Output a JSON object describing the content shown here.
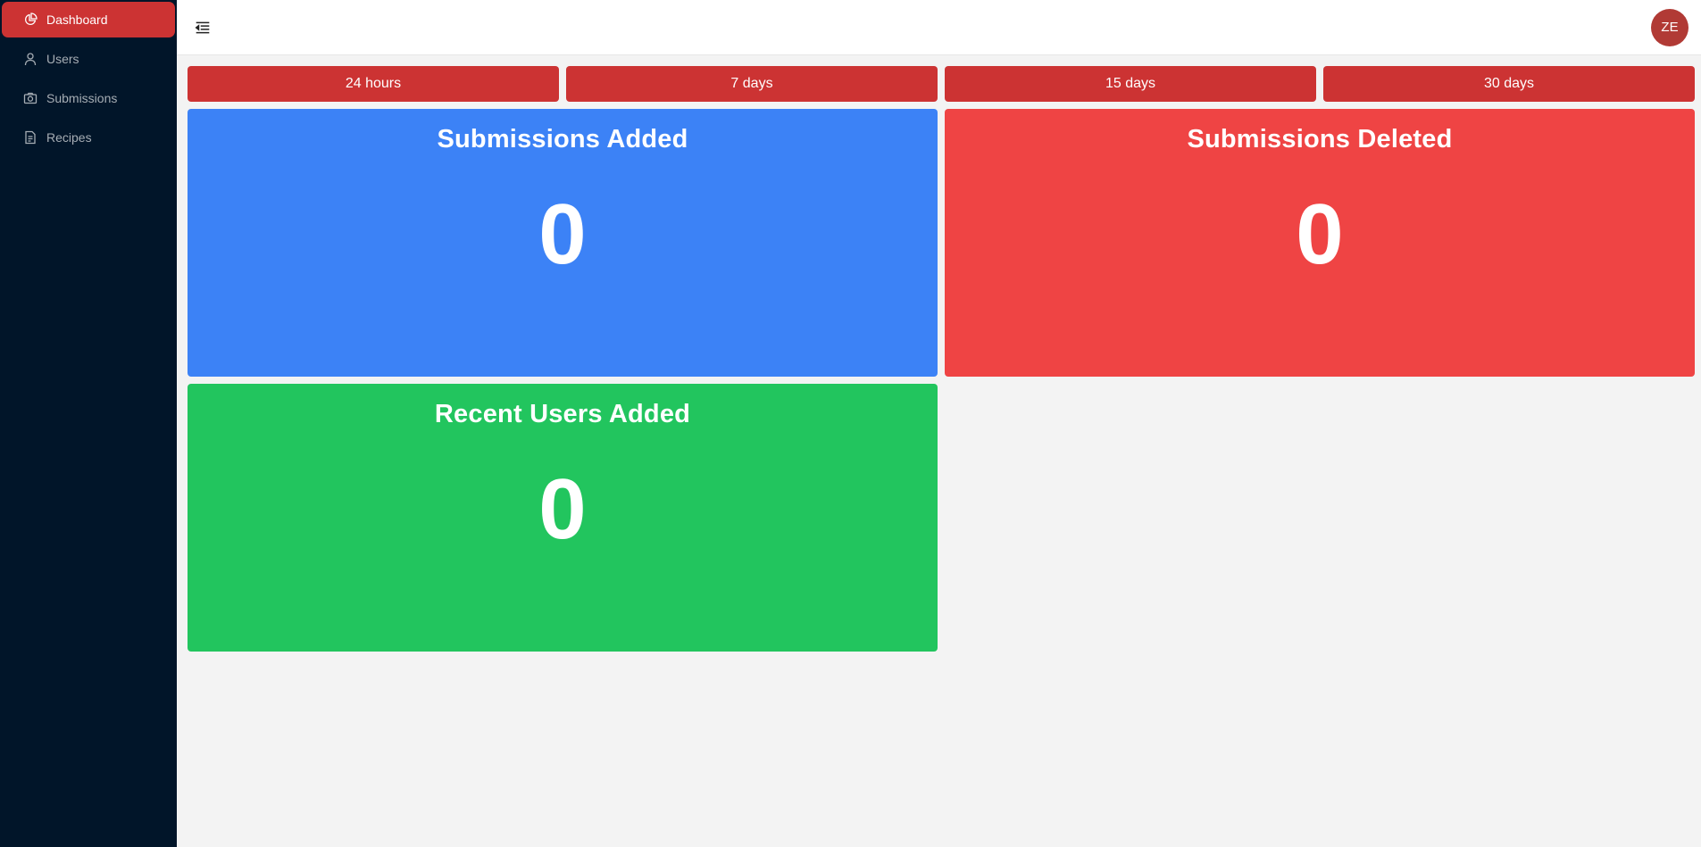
{
  "sidebar": {
    "items": [
      {
        "label": "Dashboard",
        "icon": "pie-chart-icon",
        "active": true
      },
      {
        "label": "Users",
        "icon": "user-icon",
        "active": false
      },
      {
        "label": "Submissions",
        "icon": "camera-icon",
        "active": false
      },
      {
        "label": "Recipes",
        "icon": "document-icon",
        "active": false
      }
    ]
  },
  "topbar": {
    "menu_icon": "menu-fold-icon",
    "avatar_initials": "ZE"
  },
  "ranges": [
    "24 hours",
    "7 days",
    "15 days",
    "30 days"
  ],
  "cards": [
    {
      "title": "Submissions Added",
      "value": "0",
      "color": "#3c82f6"
    },
    {
      "title": "Submissions Deleted",
      "value": "0",
      "color": "#ef4444"
    },
    {
      "title": "Recent Users Added",
      "value": "0",
      "color": "#22c55e"
    }
  ],
  "colors": {
    "sidebar_bg": "#011529",
    "accent": "#cc3333",
    "avatar": "#b13a35"
  }
}
